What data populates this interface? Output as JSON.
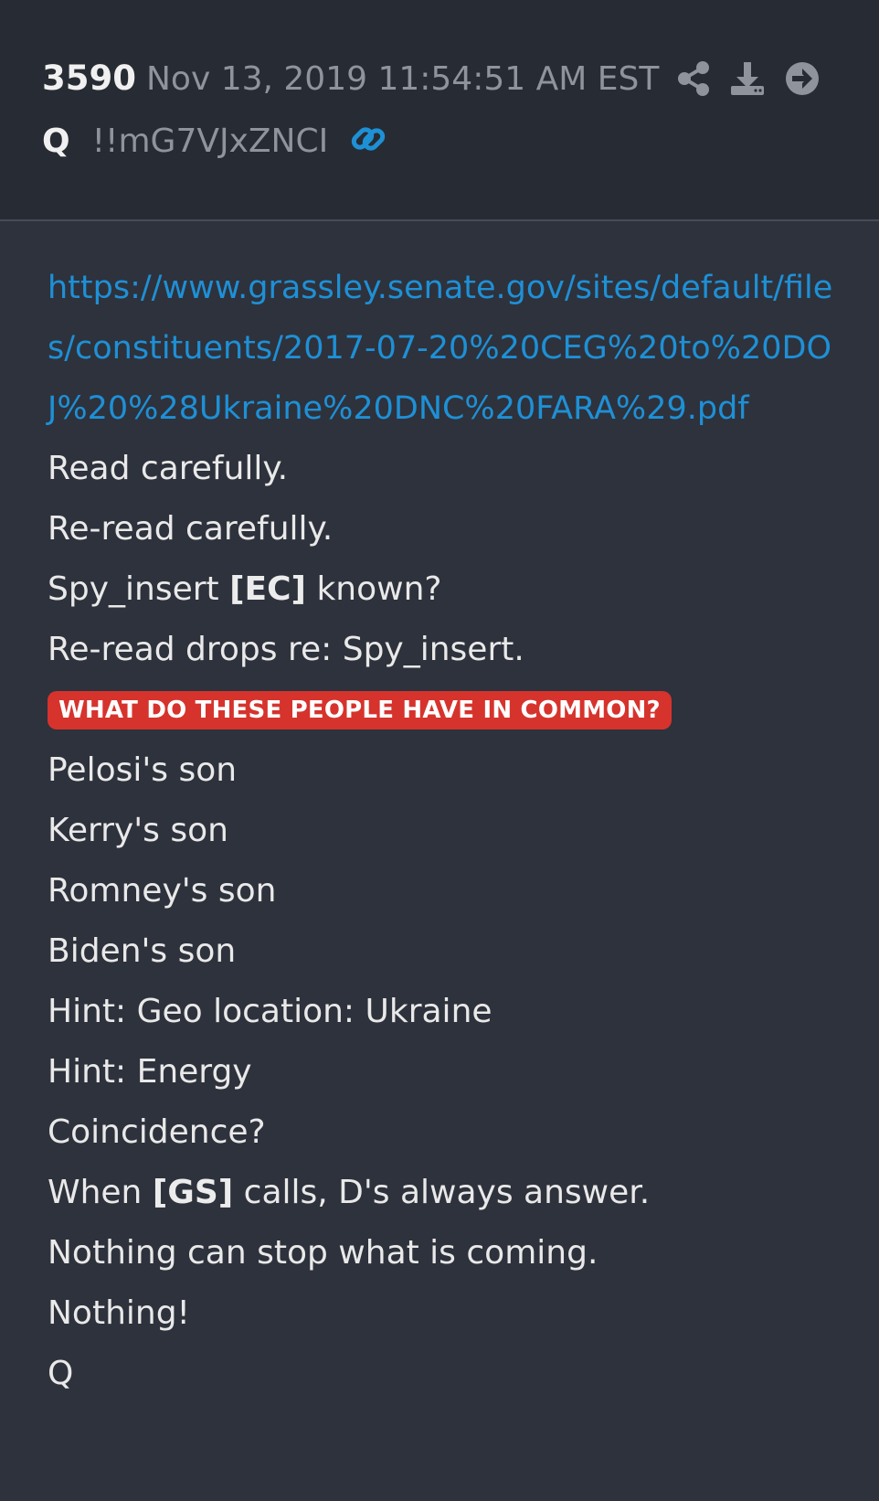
{
  "post": {
    "number": "3590",
    "timestamp": "Nov 13, 2019 11:54:51 AM EST",
    "author": "Q",
    "tripcode": "!!mG7VJxZNCI",
    "url": "https://www.grassley.senate.gov/sites/default/files/constituents/2017-07-20%20CEG%20to%20DOJ%20%28Ukraine%20DNC%20FARA%29.pdf",
    "lines_a": [
      "Read carefully.",
      "Re-read carefully."
    ],
    "line_ec": {
      "before": "Spy_insert ",
      "bold": "[EC]",
      "after": " known?"
    },
    "line_reread": "Re-read drops re: Spy_insert.",
    "badge": "WHAT DO THESE PEOPLE HAVE IN COMMON?",
    "lines_b": [
      "Pelosi's son",
      "Kerry's son",
      "Romney's son",
      "Biden's son",
      "Hint: Geo location: Ukraine",
      "Hint: Energy",
      "Coincidence?"
    ],
    "line_gs": {
      "before": "When ",
      "bold": "[GS]",
      "after": " calls, D's always answer."
    },
    "lines_c": [
      "Nothing can stop what is coming.",
      "Nothing!",
      "Q"
    ]
  },
  "icons": [
    "share-icon",
    "download-icon",
    "arrow-right-circle-icon",
    "link-icon"
  ],
  "colors": {
    "background": "#2e323c",
    "header_background": "#272b33",
    "link": "#1e90d6",
    "badge": "#d6332d"
  }
}
